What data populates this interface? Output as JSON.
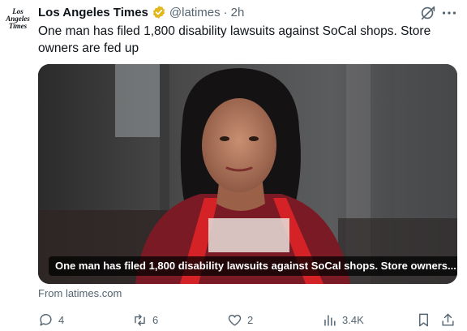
{
  "account": {
    "avatar_lines": [
      "Los",
      "Angeles",
      "Times"
    ],
    "name": "Los Angeles Times",
    "handle": "@latimes",
    "separator": "·",
    "time": "2h",
    "verified_color": "#E2B719"
  },
  "tweet": {
    "text": "One man has filed 1,800 disability lawsuits against SoCal shops. Store owners are fed up"
  },
  "card": {
    "caption": "One man has filed 1,800 disability lawsuits against SoCal shops. Store owners...",
    "source": "From latimes.com",
    "image_icon": "photo-of-woman-in-red-apron"
  },
  "actions": {
    "replies": "4",
    "reposts": "6",
    "likes": "2",
    "views": "3.4K"
  },
  "icons": {
    "grok": "grok-icon",
    "more": "more-icon",
    "reply": "reply-icon",
    "repost": "repost-icon",
    "like": "like-icon",
    "views": "views-icon",
    "bookmark": "bookmark-icon",
    "share": "share-icon"
  },
  "colors": {
    "text": "#0f1419",
    "secondary": "#536471"
  }
}
